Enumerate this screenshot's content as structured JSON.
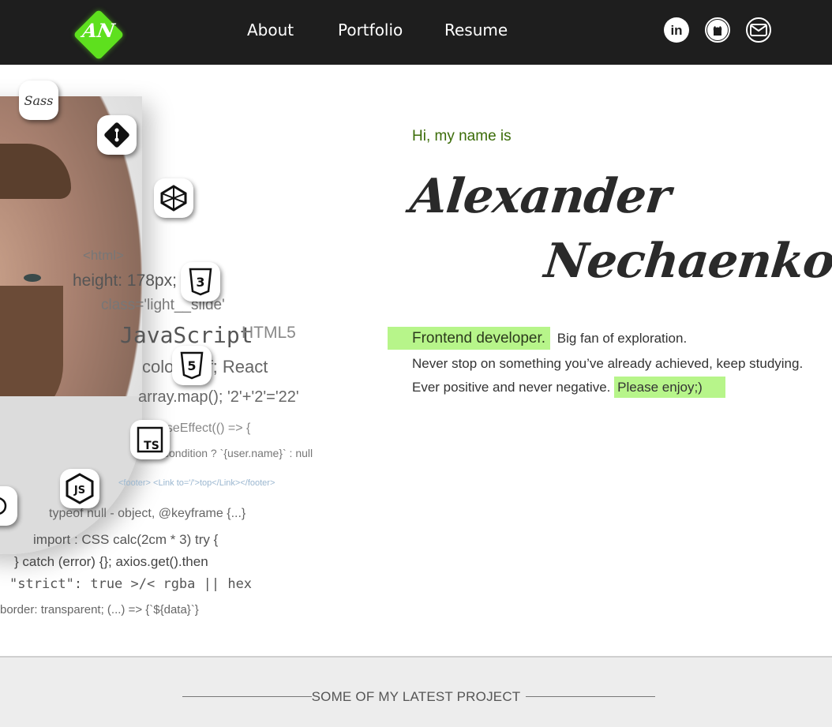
{
  "header": {
    "logo_text": "AN",
    "nav": [
      {
        "label": "About"
      },
      {
        "label": "Portfolio"
      },
      {
        "label": "Resume"
      }
    ],
    "social": [
      "linkedin-icon",
      "github-icon",
      "mail-icon"
    ]
  },
  "hero": {
    "greeting": "Hi, my name is",
    "first_name": "Alexander",
    "last_name": "Nechaenkov.",
    "role": "Frontend developer.",
    "line1_rest": "Big fan of exploration.",
    "line2": "Never stop on something you’ve already achieved, keep studying.",
    "line3": "Ever positive and never negative.",
    "line3_highlight": "Please enjoy;)"
  },
  "code_snippets": [
    "<html>",
    "height: 178px;",
    "class='light__slide'",
    "JavaScript",
    "HTML5",
    "color: #fff; React",
    "array.map(); '2'+'2'='22'",
    "useEffect(() => {",
    "init(); condition ? `{user.name}` : null",
    "<footer> <Link to='/'>top</Link></footer>",
    "typeof null - object, @keyframe {...}",
    "import : CSS  calc(2cm * 3) try {",
    "} catch (error) {}; axios.get().then",
    "\"strict\": true >/<  rgba || hex",
    "border:  transparent; (...) => {`${data}`}"
  ],
  "tech_badges": [
    "sass-icon",
    "git-icon",
    "codepen-icon",
    "css3-icon",
    "html5-icon",
    "typescript-icon",
    "nodejs-icon",
    "redux-icon"
  ],
  "projects": {
    "title": "SOME OF MY LATEST PROJECT"
  },
  "colors": {
    "header_bg": "#1e1e1e",
    "accent_green": "#5ee01e",
    "highlight": "#b7f58a",
    "greeting": "#3b6c08"
  }
}
